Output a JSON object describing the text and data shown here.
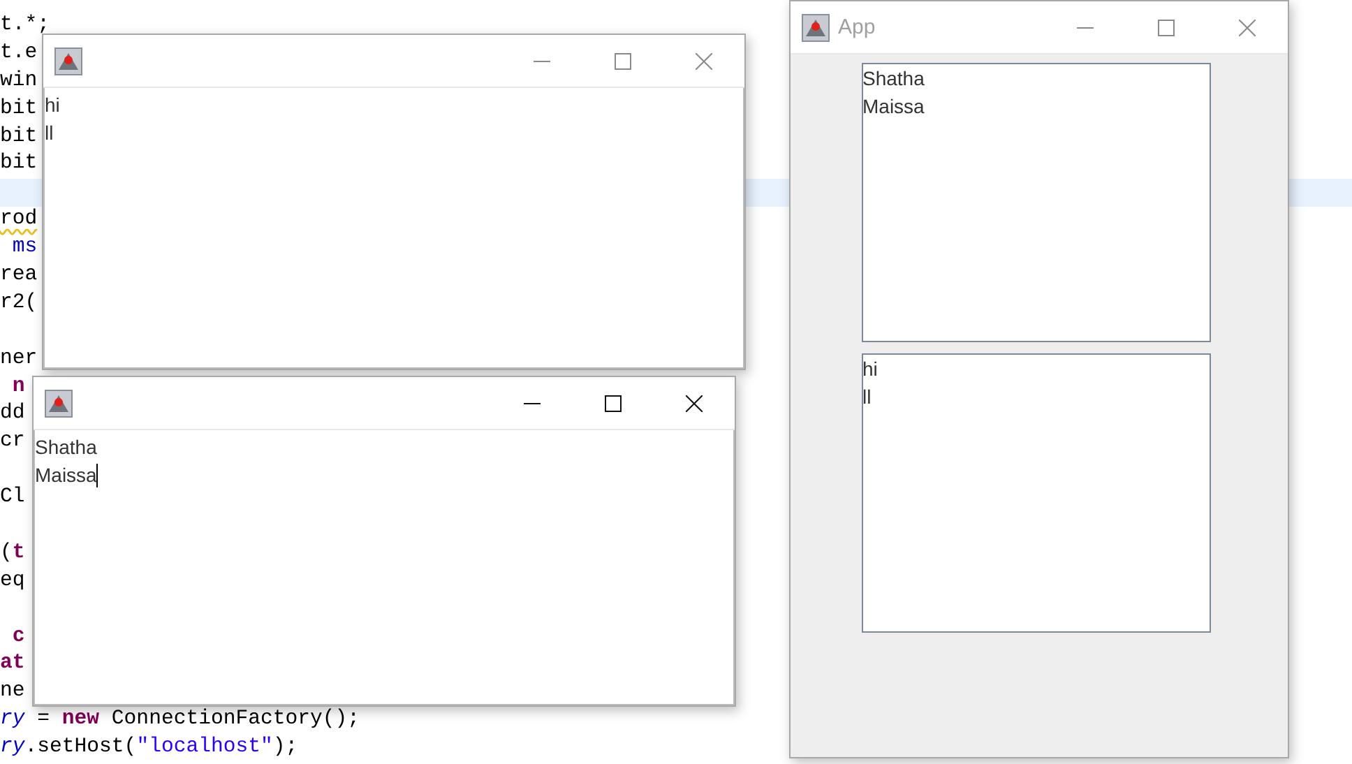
{
  "editor": {
    "lines": [
      {
        "kind": "code",
        "tokens": [
          {
            "kind": "plain",
            "text": "t.*;"
          }
        ]
      },
      {
        "kind": "code",
        "tokens": [
          {
            "kind": "plain",
            "text": "t.e"
          }
        ]
      },
      {
        "kind": "code",
        "tokens": [
          {
            "kind": "plain",
            "text": "win"
          }
        ]
      },
      {
        "kind": "code",
        "tokens": [
          {
            "kind": "plain",
            "text": "bit"
          }
        ]
      },
      {
        "kind": "code",
        "tokens": [
          {
            "kind": "plain",
            "text": "bit"
          }
        ]
      },
      {
        "kind": "code",
        "tokens": [
          {
            "kind": "plain",
            "text": "bit"
          }
        ]
      },
      {
        "kind": "blank",
        "current": true
      },
      {
        "kind": "code",
        "tokens": [
          {
            "kind": "warning",
            "text": "rod"
          }
        ]
      },
      {
        "kind": "code",
        "tokens": [
          {
            "kind": "field",
            "text": " ms"
          }
        ]
      },
      {
        "kind": "code",
        "tokens": [
          {
            "kind": "plain",
            "text": "rea"
          }
        ]
      },
      {
        "kind": "code",
        "tokens": [
          {
            "kind": "plain",
            "text": "r2("
          }
        ]
      },
      {
        "kind": "blank"
      },
      {
        "kind": "code",
        "tokens": [
          {
            "kind": "plain",
            "text": "ner"
          }
        ]
      },
      {
        "kind": "code",
        "tokens": [
          {
            "kind": "keyword",
            "text": " n"
          }
        ]
      },
      {
        "kind": "code",
        "tokens": [
          {
            "kind": "plain",
            "text": "dd"
          }
        ]
      },
      {
        "kind": "code",
        "tokens": [
          {
            "kind": "plain",
            "text": "cr"
          }
        ]
      },
      {
        "kind": "blank"
      },
      {
        "kind": "code",
        "tokens": [
          {
            "kind": "plain",
            "text": "Cl"
          }
        ]
      },
      {
        "kind": "blank"
      },
      {
        "kind": "code",
        "tokens": [
          {
            "kind": "plain",
            "text": "("
          },
          {
            "kind": "keyword",
            "text": "t"
          }
        ]
      },
      {
        "kind": "code",
        "tokens": [
          {
            "kind": "plain",
            "text": "eq"
          }
        ]
      },
      {
        "kind": "blank"
      },
      {
        "kind": "code",
        "tokens": [
          {
            "kind": "keyword",
            "text": " c"
          }
        ]
      },
      {
        "kind": "code",
        "tokens": [
          {
            "kind": "keyword",
            "text": "at"
          }
        ]
      },
      {
        "kind": "code",
        "tokens": [
          {
            "kind": "plain",
            "text": "ne"
          }
        ]
      },
      {
        "kind": "code",
        "tokens": [
          {
            "kind": "variable",
            "text": "ry"
          },
          {
            "kind": "plain",
            "text": " = "
          },
          {
            "kind": "keyword",
            "text": "new"
          },
          {
            "kind": "plain",
            "text": " ConnectionFactory();"
          }
        ]
      },
      {
        "kind": "code",
        "tokens": [
          {
            "kind": "variable",
            "text": "ry"
          },
          {
            "kind": "plain",
            "text": ".setHost("
          },
          {
            "kind": "string",
            "text": "\"localhost\""
          },
          {
            "kind": "plain",
            "text": ");"
          }
        ]
      }
    ]
  },
  "windows": [
    {
      "active": false,
      "areas": [
        {
          "lines": [
            "hi",
            "ll"
          ],
          "caret": false
        }
      ]
    },
    {
      "active": true,
      "areas": [
        {
          "lines": [
            "Shatha",
            "Maissa"
          ],
          "caret": true
        }
      ]
    },
    {
      "title": "App",
      "active": false,
      "areas": [
        {
          "lines": [
            "Shatha",
            "Maissa"
          ],
          "caret": false
        },
        {
          "lines": [
            "hi",
            "ll"
          ],
          "caret": false
        }
      ]
    }
  ]
}
